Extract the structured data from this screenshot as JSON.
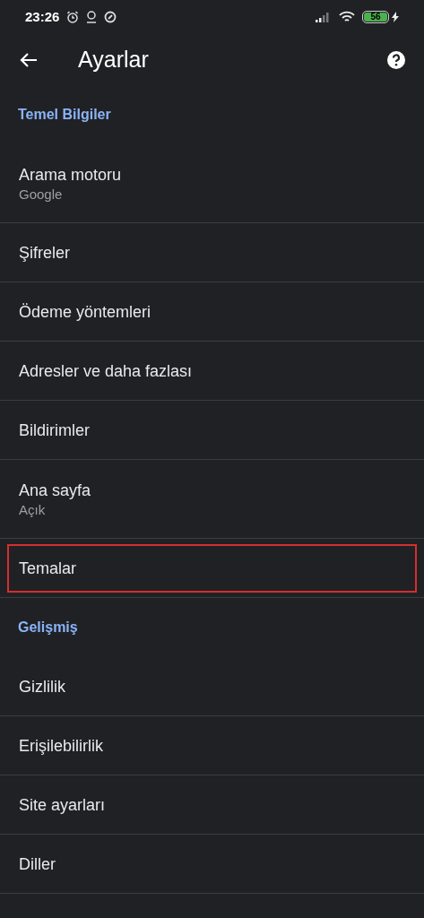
{
  "status_bar": {
    "time": "23:26",
    "battery": "56"
  },
  "toolbar": {
    "title": "Ayarlar"
  },
  "sections": [
    {
      "header": "Temel Bilgiler",
      "items": [
        {
          "title": "Arama motoru",
          "subtitle": "Google",
          "highlighted": false
        },
        {
          "title": "Şifreler",
          "highlighted": false
        },
        {
          "title": "Ödeme yöntemleri",
          "highlighted": false
        },
        {
          "title": "Adresler ve daha fazlası",
          "highlighted": false
        },
        {
          "title": "Bildirimler",
          "highlighted": false
        },
        {
          "title": "Ana sayfa",
          "subtitle": "Açık",
          "highlighted": false
        },
        {
          "title": "Temalar",
          "highlighted": true
        }
      ]
    },
    {
      "header": "Gelişmiş",
      "items": [
        {
          "title": "Gizlilik",
          "highlighted": false
        },
        {
          "title": "Erişilebilirlik",
          "highlighted": false
        },
        {
          "title": "Site ayarları",
          "highlighted": false
        },
        {
          "title": "Diller",
          "highlighted": false
        }
      ]
    }
  ]
}
